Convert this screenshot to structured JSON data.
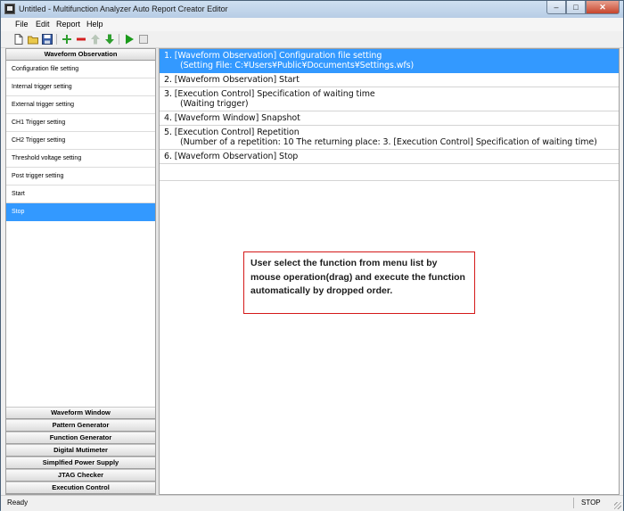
{
  "window": {
    "title": "Untitled - Multifunction Analyzer Auto Report Creator Editor",
    "minimize": "–",
    "maximize": "□",
    "close": "✕"
  },
  "menu": [
    "File",
    "Edit",
    "Report",
    "Help"
  ],
  "toolbar": {
    "icons": [
      "new-file-icon",
      "open-folder-icon",
      "save-icon",
      "add-icon",
      "remove-icon",
      "move-up-icon",
      "move-down-icon",
      "run-icon",
      "stop-icon"
    ],
    "colors": {
      "add": "#2e9e2e",
      "remove": "#d42020",
      "run": "#1a9a1a",
      "stop": "#9a9a9a"
    }
  },
  "sidebar": {
    "active_group": "Waveform Observation",
    "items": [
      "Configuration file setting",
      "Internal trigger setting",
      "External trigger setting",
      "CH1 Trigger setting",
      "CH2 Trigger setting",
      "Threshold voltage setting",
      "Post trigger setting",
      "Start",
      "Stop"
    ],
    "selected_index": 8,
    "groups": [
      "Waveform Window",
      "Pattern Generator",
      "Function Generator",
      "Digital Mutimeter",
      "Simplfied Power Supply",
      "JTAG Checker",
      "Execution Control"
    ]
  },
  "steps": [
    {
      "line1": "1. [Waveform Observation] Configuration file setting",
      "line2": "(Setting File: C:¥Users¥Public¥Documents¥Settings.wfs)"
    },
    {
      "line1": "2. [Waveform Observation] Start",
      "line2": ""
    },
    {
      "line1": "3. [Execution Control] Specification of waiting time",
      "line2": "(Waiting trigger)"
    },
    {
      "line1": "4. [Waveform Window] Snapshot",
      "line2": ""
    },
    {
      "line1": "5. [Execution Control] Repetition",
      "line2": "(Number of a repetition: 10  The returning place: 3. [Execution Control] Specification of waiting time)"
    },
    {
      "line1": "6. [Waveform Observation] Stop",
      "line2": ""
    }
  ],
  "selected_step_index": 0,
  "callout": {
    "text": "User select the function from menu list by mouse operation(drag) and execute the function automatically by dropped order.",
    "border_color": "#d41919"
  },
  "status": {
    "left": "Ready",
    "right": "STOP"
  },
  "accent": "#3399ff"
}
